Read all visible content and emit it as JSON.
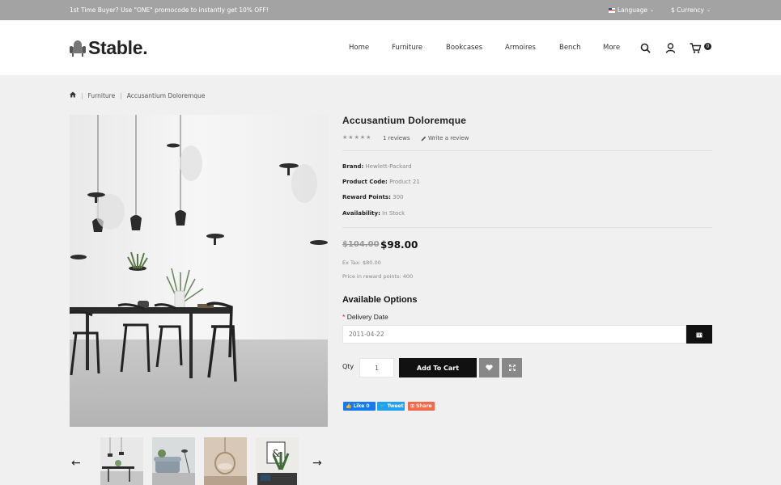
{
  "topbar": {
    "promo": "1st Time Buyer? Use \"ONE\" promocode to instantly get 10% OFF!",
    "language": "Language",
    "currency": "$ Currency"
  },
  "header": {
    "logo": "Stable.",
    "nav": [
      "Home",
      "Furniture",
      "Bookcases",
      "Armoires",
      "Bench",
      "More"
    ],
    "cart_count": "0"
  },
  "breadcrumb": [
    "Furniture",
    "Accusantium Doloremque"
  ],
  "product": {
    "title": "Accusantium Doloremque",
    "reviews": "1 reviews",
    "write_review": "Write a review",
    "specs": [
      {
        "label": "Brand:",
        "value": "Hewlett-Packard"
      },
      {
        "label": "Product Code:",
        "value": "Product 21"
      },
      {
        "label": "Reward Points:",
        "value": "300"
      },
      {
        "label": "Availability:",
        "value": "In Stock"
      }
    ],
    "old_price": "$104.00",
    "price": "$98.00",
    "ex_tax": "Ex Tax: $80.00",
    "reward_points": "Price in reward points: 400"
  },
  "options": {
    "heading": "Available Options",
    "required_mark": "*",
    "delivery_label": "Delivery Date",
    "delivery_value": "2011-04-22"
  },
  "cart": {
    "qty_label": "Qty",
    "qty_value": "1",
    "add_label": "Add To Cart"
  },
  "social": {
    "fb": "Like 0",
    "tw": "Tweet",
    "share": "Share"
  },
  "colors": {
    "topbar": "#a3a3a3",
    "accent": "#111111",
    "page_bg": "#f0f0f0"
  }
}
